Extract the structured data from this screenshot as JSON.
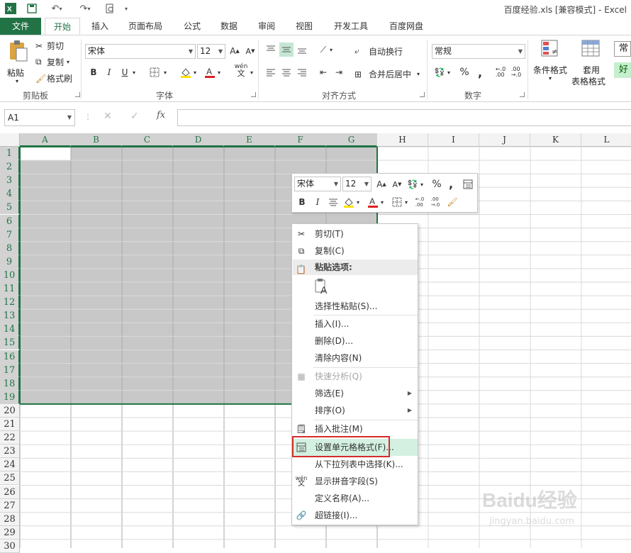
{
  "window": {
    "title": "百度经验.xls  [兼容模式] - Excel"
  },
  "tabs": [
    {
      "label": "文件"
    },
    {
      "label": "开始"
    },
    {
      "label": "插入"
    },
    {
      "label": "页面布局"
    },
    {
      "label": "公式"
    },
    {
      "label": "数据"
    },
    {
      "label": "审阅"
    },
    {
      "label": "视图"
    },
    {
      "label": "开发工具"
    },
    {
      "label": "百度网盘"
    }
  ],
  "ribbon": {
    "clipboard": {
      "paste": "粘贴",
      "cut": "剪切",
      "copy": "复制",
      "painter": "格式刷",
      "group": "剪贴板"
    },
    "font": {
      "name": "宋体",
      "size": "12",
      "group": "字体",
      "bold": "B",
      "italic": "I",
      "underline": "U"
    },
    "alignment": {
      "wrap": "自动换行",
      "merge": "合并后居中",
      "group": "对齐方式"
    },
    "number": {
      "format": "常规",
      "percent": "%",
      "comma": ",",
      "group": "数字"
    },
    "styles": {
      "cond": "条件格式",
      "table1": "套用",
      "table2": "表格格式",
      "normal": "常",
      "good": "好"
    }
  },
  "formula_bar": {
    "name_box": "A1",
    "fx": "fx"
  },
  "columns": [
    "A",
    "B",
    "C",
    "D",
    "E",
    "F",
    "G",
    "H",
    "I",
    "J",
    "K",
    "L"
  ],
  "rows": [
    "1",
    "2",
    "3",
    "4",
    "5",
    "6",
    "7",
    "8",
    "9",
    "10",
    "11",
    "12",
    "13",
    "14",
    "15",
    "16",
    "17",
    "18",
    "19",
    "20",
    "21",
    "22",
    "23",
    "24",
    "25",
    "26",
    "27",
    "28",
    "29",
    "30"
  ],
  "mini_toolbar": {
    "font": "宋体",
    "size": "12",
    "bold": "B",
    "italic": "I",
    "percent": "%",
    "comma": ","
  },
  "context_menu": {
    "items": [
      {
        "label": "剪切(T)",
        "icon": "scissors-icon"
      },
      {
        "label": "复制(C)",
        "icon": "copy-icon"
      },
      {
        "label": "粘贴选项:",
        "icon": "clipboard-icon"
      },
      {
        "label": "选择性粘贴(S)..."
      },
      {
        "label": "插入(I)..."
      },
      {
        "label": "删除(D)..."
      },
      {
        "label": "清除内容(N)"
      },
      {
        "label": "快速分析(Q)",
        "icon": "quick-analysis-icon"
      },
      {
        "label": "筛选(E)"
      },
      {
        "label": "排序(O)"
      },
      {
        "label": "插入批注(M)",
        "icon": "comment-icon"
      },
      {
        "label": "设置单元格格式(F)...",
        "icon": "format-cells-icon"
      },
      {
        "label": "从下拉列表中选择(K)..."
      },
      {
        "label": "显示拼音字段(S)",
        "icon": "pinyin-icon"
      },
      {
        "label": "定义名称(A)..."
      },
      {
        "label": "超链接(I)...",
        "icon": "hyperlink-icon"
      }
    ]
  },
  "watermark": {
    "brand": "Baidu经验",
    "url": "jingyan.baidu.com"
  },
  "colors": {
    "excel_green": "#217346",
    "selection": "#c8c8c8",
    "highlight_box": "#d62b2b",
    "menu_highlight": "#d3f0e0"
  }
}
